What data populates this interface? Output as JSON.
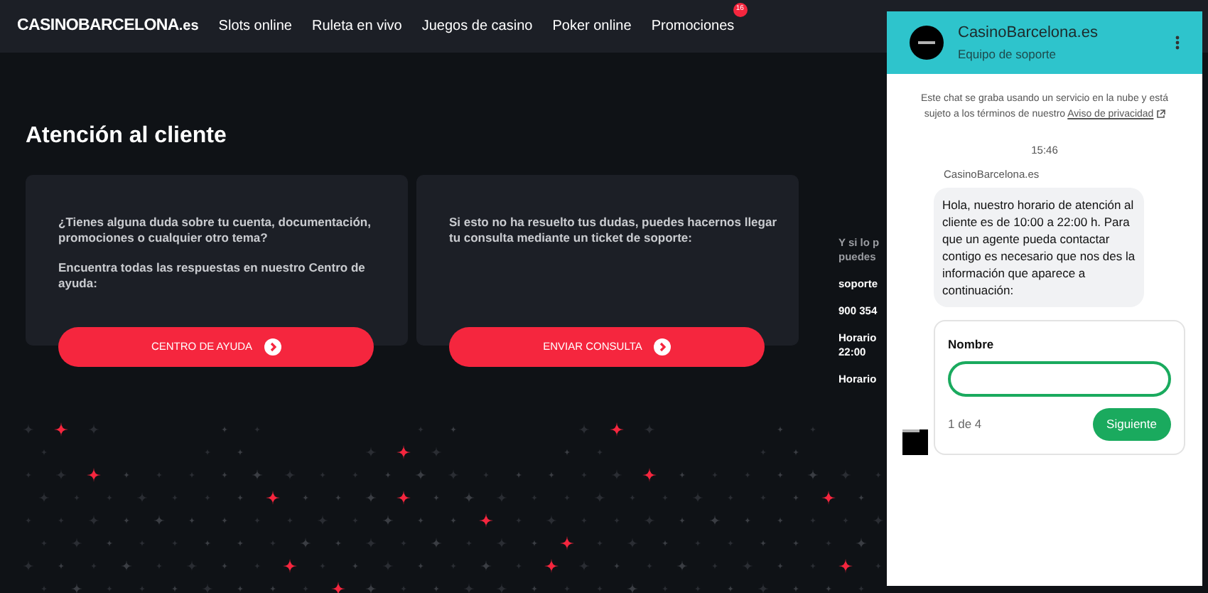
{
  "header": {
    "logo_main": "CASINOBARCELONA",
    "logo_suffix": ".es",
    "nav": [
      {
        "label": "Slots online"
      },
      {
        "label": "Ruleta en vivo"
      },
      {
        "label": "Juegos de casino"
      },
      {
        "label": "Poker online"
      },
      {
        "label": "Promociones",
        "badge": "16"
      }
    ]
  },
  "page": {
    "title": "Atención al cliente",
    "cards": [
      {
        "paragraphs": [
          "¿Tienes alguna duda sobre tu cuenta, documentación, promociones o cualquier otro tema?",
          "Encuentra todas las respuestas en nuestro Centro de ayuda:"
        ],
        "button": "CENTRO DE AYUDA"
      },
      {
        "paragraphs": [
          "Si esto no ha resuelto tus dudas, puedes hacernos llegar tu consulta mediante un ticket de soporte:"
        ],
        "button": "ENVIAR CONSULTA"
      }
    ],
    "side": [
      {
        "kind": "note",
        "lines": [
          "Y si lo p",
          "puedes"
        ]
      },
      {
        "kind": "strong",
        "lines": [
          "soporte"
        ]
      },
      {
        "kind": "strong",
        "lines": [
          "900 354"
        ]
      },
      {
        "kind": "strong",
        "lines": [
          "Horario",
          "22:00"
        ]
      },
      {
        "kind": "strong",
        "lines": [
          "Horario"
        ]
      }
    ]
  },
  "chat": {
    "title": "CasinoBarcelona.es",
    "subtitle": "Equipo de soporte",
    "notice": "Este chat se graba usando un servicio en la nube y está sujeto a los términos de nuestro",
    "notice_link": "Aviso de privacidad",
    "time": "15:46",
    "sender": "CasinoBarcelona.es",
    "message": "Hola, nuestro horario de atención al cliente es de 10:00 a 22:00 h. Para que un agente pueda contactar contigo es necesario que nos des la información que aparece a continuación:",
    "form": {
      "label": "Nombre",
      "step": "1 de 4",
      "button": "Siguiente"
    }
  }
}
